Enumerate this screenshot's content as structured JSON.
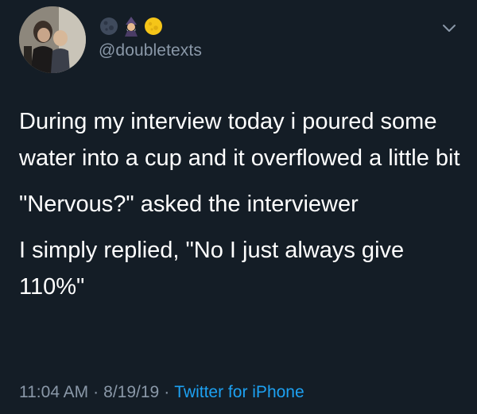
{
  "tweet": {
    "handle": "@doubletexts",
    "emojis": [
      "new-moon-icon",
      "mage-icon",
      "full-moon-icon"
    ],
    "paragraphs": [
      "During my interview today i poured some water into a cup and it overflowed a little bit",
      "\"Nervous?\" asked the interviewer",
      "I simply replied, \"No I just always give 110%\""
    ],
    "time": "11:04 AM",
    "date": "8/19/19",
    "source": "Twitter for iPhone",
    "separator": "·"
  },
  "colors": {
    "background": "#141d26",
    "text": "#ffffff",
    "muted": "#8a98a8",
    "link": "#1da1f2"
  }
}
